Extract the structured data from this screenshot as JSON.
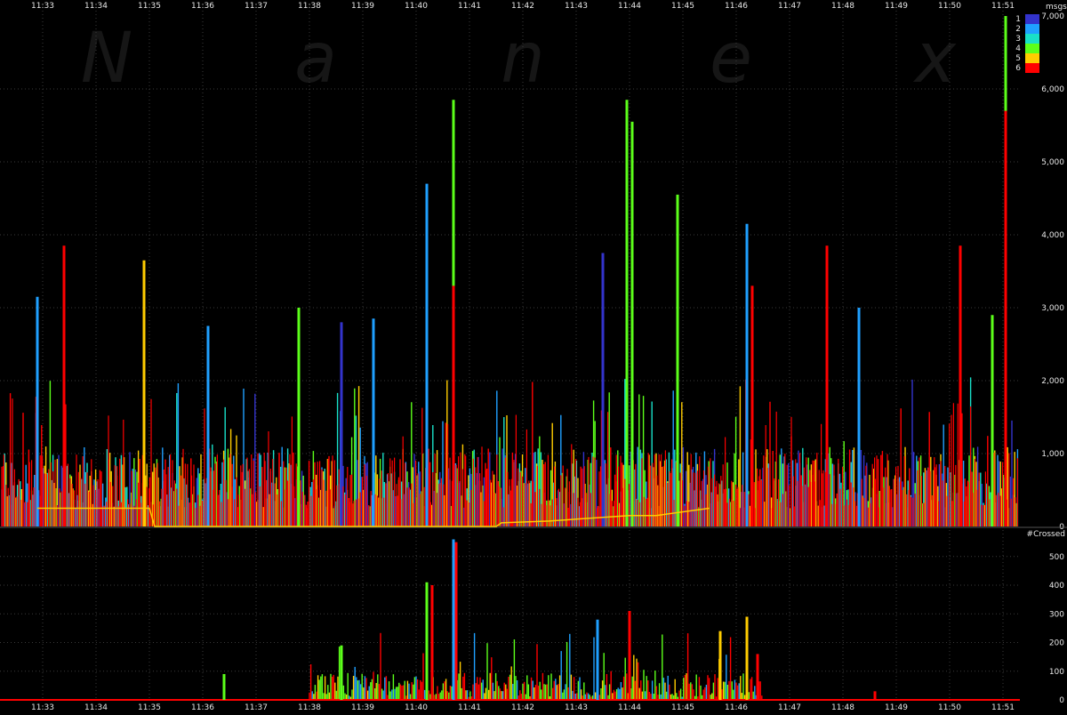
{
  "watermark": [
    "N",
    "a",
    "n",
    "e",
    "x"
  ],
  "time_labels": [
    "11:33",
    "11:34",
    "11:35",
    "11:36",
    "11:37",
    "11:38",
    "11:39",
    "11:40",
    "11:41",
    "11:42",
    "11:43",
    "11:44",
    "11:45",
    "11:46",
    "11:47",
    "11:48",
    "11:49",
    "11:50",
    "11:51"
  ],
  "colors": {
    "background": "#000000",
    "grid": "#3a3a3a",
    "text": "#e6e6e6",
    "exchange": {
      "1": "#3333cc",
      "2": "#1fa0ff",
      "3": "#19e0c8",
      "4": "#5cff1a",
      "5": "#ffcc00",
      "6": "#ff0000"
    }
  },
  "legend": {
    "title": "msgs",
    "items": [
      "1",
      "2",
      "3",
      "4",
      "5",
      "6"
    ]
  },
  "chart_data": [
    {
      "type": "bar",
      "ylabel": "msgs",
      "ylim": [
        0,
        7000
      ],
      "yticks": [
        "0",
        "1,000",
        "2,000",
        "3,000",
        "4,000",
        "5,000",
        "6,000",
        "7,000"
      ],
      "ytick_values": [
        0,
        1000,
        2000,
        3000,
        4000,
        5000,
        6000,
        7000
      ],
      "x_range": [
        "11:33",
        "11:51"
      ],
      "grid": true,
      "legend_position": "top-right",
      "series_names": [
        "1",
        "2",
        "3",
        "4",
        "5",
        "6"
      ],
      "spikes": [
        {
          "time": "11:32.9",
          "value": 3150,
          "series": "2"
        },
        {
          "time": "11:33.4",
          "value": 3850,
          "series": "6"
        },
        {
          "time": "11:34.9",
          "value": 3650,
          "series": "5"
        },
        {
          "time": "11:36.1",
          "value": 2750,
          "series": "2"
        },
        {
          "time": "11:37.8",
          "value": 3000,
          "series": "4"
        },
        {
          "time": "11:38.6",
          "value": 2800,
          "series": "1"
        },
        {
          "time": "11:39.2",
          "value": 2850,
          "series": "2"
        },
        {
          "time": "11:40.2",
          "value": 4700,
          "series": "2"
        },
        {
          "time": "11:40.7",
          "value": 5850,
          "series": "4"
        },
        {
          "time": "11:40.7",
          "value": 3300,
          "series": "6"
        },
        {
          "time": "11:43.5",
          "value": 3750,
          "series": "1"
        },
        {
          "time": "11:43.95",
          "value": 5850,
          "series": "4"
        },
        {
          "time": "11:44.05",
          "value": 5550,
          "series": "4"
        },
        {
          "time": "11:44.9",
          "value": 4550,
          "series": "4"
        },
        {
          "time": "11:46.2",
          "value": 4150,
          "series": "2"
        },
        {
          "time": "11:46.3",
          "value": 3300,
          "series": "6"
        },
        {
          "time": "11:47.7",
          "value": 3850,
          "series": "6"
        },
        {
          "time": "11:48.3",
          "value": 3000,
          "series": "2"
        },
        {
          "time": "11:50.2",
          "value": 3850,
          "series": "6"
        },
        {
          "time": "11:50.8",
          "value": 2900,
          "series": "4"
        },
        {
          "time": "11:51.05",
          "value": 7000,
          "series": "4"
        },
        {
          "time": "11:51.05",
          "value": 5700,
          "series": "6"
        }
      ],
      "typical_range": [
        250,
        1100
      ],
      "yellow_line": [
        {
          "time": "11:32.9",
          "value": 250
        },
        {
          "time": "11:35.0",
          "value": 250
        },
        {
          "time": "11:35.1",
          "value": 0
        },
        {
          "time": "11:41.5",
          "value": 0
        },
        {
          "time": "11:41.6",
          "value": 50
        },
        {
          "time": "11:42.5",
          "value": 75
        },
        {
          "time": "11:43.0",
          "value": 100
        },
        {
          "time": "11:44.0",
          "value": 150
        },
        {
          "time": "11:44.5",
          "value": 150
        },
        {
          "time": "11:45.5",
          "value": 250
        }
      ]
    },
    {
      "type": "bar",
      "ylabel": "#Crossed",
      "ylim": [
        0,
        580
      ],
      "yticks": [
        "0",
        "100",
        "200",
        "300",
        "400",
        "500"
      ],
      "ytick_values": [
        0,
        100,
        200,
        300,
        400,
        500
      ],
      "x_range": [
        "11:33",
        "11:51"
      ],
      "grid": true,
      "active_range": [
        "11:38",
        "11:46.5"
      ],
      "spikes": [
        {
          "time": "11:36.4",
          "value": 90,
          "series": "4"
        },
        {
          "time": "11:38.6",
          "value": 190,
          "series": "4"
        },
        {
          "time": "11:40.2",
          "value": 410,
          "series": "4"
        },
        {
          "time": "11:40.3",
          "value": 400,
          "series": "6"
        },
        {
          "time": "11:40.7",
          "value": 560,
          "series": "2"
        },
        {
          "time": "11:40.75",
          "value": 550,
          "series": "6"
        },
        {
          "time": "11:43.4",
          "value": 280,
          "series": "2"
        },
        {
          "time": "11:44.0",
          "value": 310,
          "series": "6"
        },
        {
          "time": "11:45.7",
          "value": 240,
          "series": "5"
        },
        {
          "time": "11:46.2",
          "value": 290,
          "series": "5"
        },
        {
          "time": "11:46.4",
          "value": 160,
          "series": "6"
        },
        {
          "time": "11:48.6",
          "value": 30,
          "series": "6"
        }
      ],
      "typical_range": [
        10,
        150
      ]
    }
  ]
}
